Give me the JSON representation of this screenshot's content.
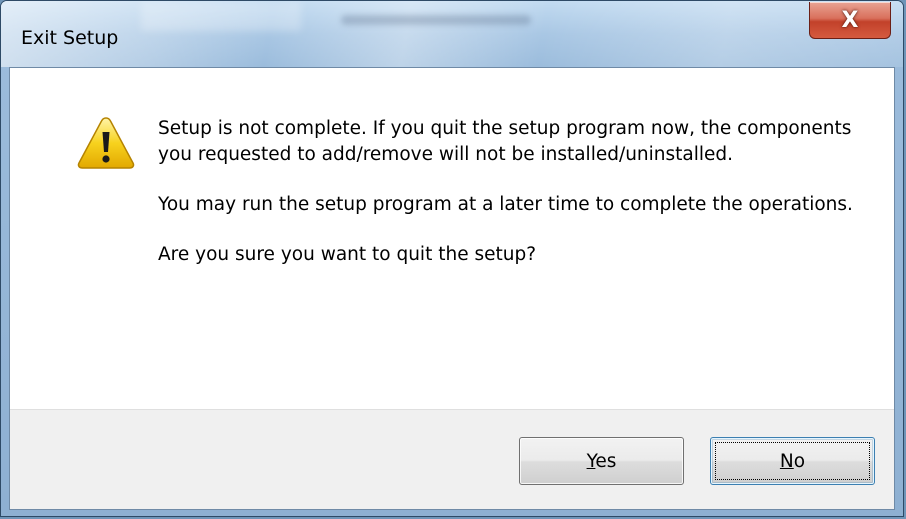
{
  "window": {
    "title": "Exit Setup",
    "close_glyph": "X"
  },
  "dialog": {
    "icon": "warning-icon",
    "message_lines": [
      "Setup is not complete. If you quit the setup program now, the components you requested to add/remove will not be installed/uninstalled.",
      "You may run the setup program at a later time to complete the operations.",
      "Are you sure you want to quit the setup?"
    ]
  },
  "buttons": {
    "yes": {
      "mnemonic": "Y",
      "rest": "es"
    },
    "no": {
      "mnemonic": "N",
      "rest": "o"
    }
  },
  "colors": {
    "close_button": "#c2412a",
    "warning_yellow": "#f7d21e",
    "button_face": "#e5e5e5",
    "focus_border": "#3c7fb1"
  }
}
